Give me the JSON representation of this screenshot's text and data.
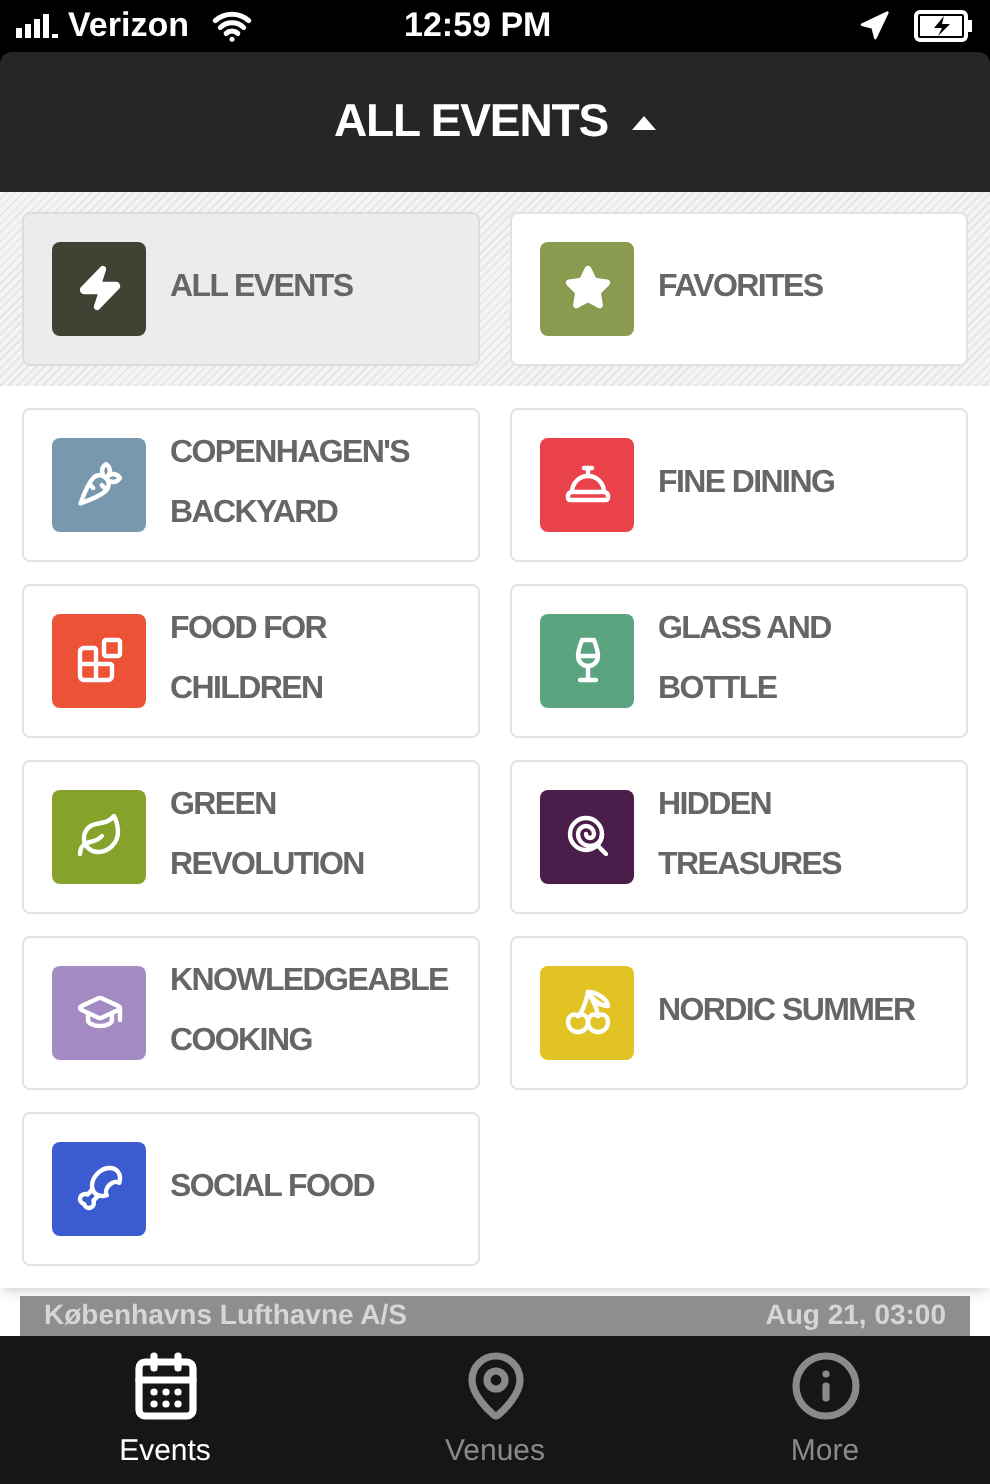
{
  "status_bar": {
    "carrier": "Verizon",
    "time": "12:59 PM"
  },
  "header": {
    "title": "ALL EVENTS",
    "expanded": true
  },
  "top_filters": [
    {
      "label": "ALL EVENTS",
      "color": "#3f4333",
      "selected": true
    },
    {
      "label": "FAVORITES",
      "color": "#8a9a4e",
      "selected": false
    }
  ],
  "categories": [
    {
      "label": "COPENHAGEN'S BACKYARD",
      "color": "#7898ad",
      "selected": false
    },
    {
      "label": "FINE DINING",
      "color": "#e9424b",
      "selected": false
    },
    {
      "label": "FOOD FOR CHILDREN",
      "color": "#ec5236",
      "selected": false
    },
    {
      "label": "GLASS AND BOTTLE",
      "color": "#5aa57f",
      "selected": false
    },
    {
      "label": "GREEN REVOLUTION",
      "color": "#85a22a",
      "selected": false
    },
    {
      "label": "HIDDEN TREASURES",
      "color": "#4b1d4b",
      "selected": false
    },
    {
      "label": "KNOWLEDGEABLE COOKING",
      "color": "#a48bc3",
      "selected": false
    },
    {
      "label": "NORDIC SUMMER",
      "color": "#e1c424",
      "selected": false
    },
    {
      "label": "SOCIAL FOOD",
      "color": "#3b5bd1",
      "selected": false
    }
  ],
  "background_event": {
    "venue": "Københavns Lufthavne A/S",
    "time": "Aug 21, 03:00"
  },
  "tab_bar": [
    {
      "label": "Events",
      "selected": true
    },
    {
      "label": "Venues",
      "selected": false
    },
    {
      "label": "More",
      "selected": false
    }
  ]
}
